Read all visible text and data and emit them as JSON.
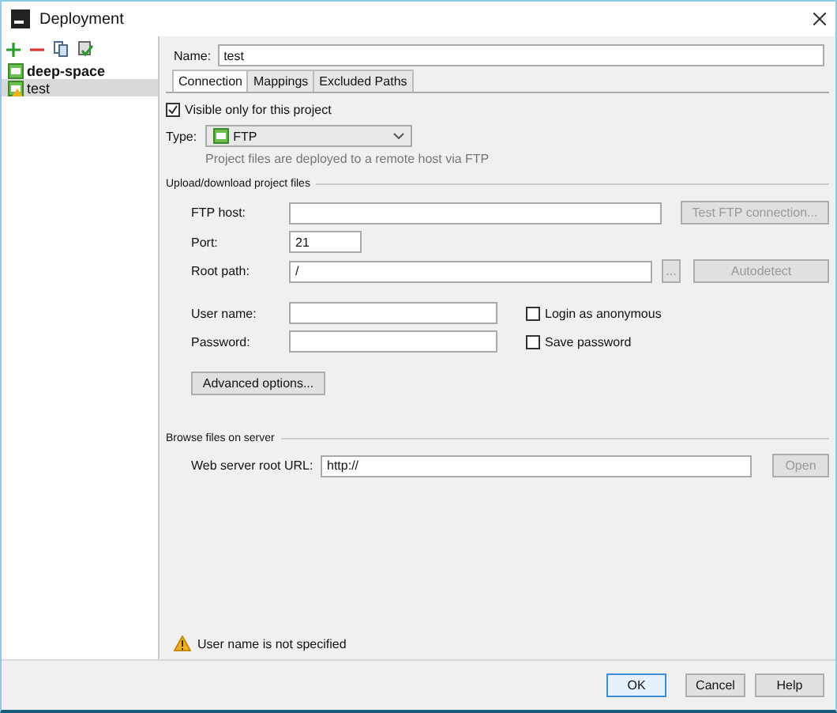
{
  "window": {
    "title": "Deployment"
  },
  "servers": [
    {
      "label": "deep-space",
      "default": true,
      "warning": false,
      "selected": false
    },
    {
      "label": "test",
      "default": false,
      "warning": true,
      "selected": true
    }
  ],
  "name": {
    "label": "Name:",
    "value": "test"
  },
  "tabs": [
    {
      "label": "Connection",
      "selected": true
    },
    {
      "label": "Mappings",
      "selected": false
    },
    {
      "label": "Excluded Paths",
      "selected": false
    }
  ],
  "visible_only": {
    "label": "Visible only for this project",
    "checked": true
  },
  "type": {
    "label": "Type:",
    "value": "FTP",
    "hint": "Project files are deployed to a remote host via FTP"
  },
  "upload_section": {
    "title": "Upload/download project files"
  },
  "ftp_host": {
    "label": "FTP host:",
    "button": {
      "label": "Test FTP connection...",
      "disabled": true
    }
  },
  "port": {
    "label": "Port:",
    "value": "21"
  },
  "root_path": {
    "label": "Root path:",
    "value": "/",
    "browse_button": {
      "label": "...",
      "disabled": true
    },
    "button": {
      "label": "Autodetect",
      "disabled": true
    }
  },
  "user_name": {
    "label": "User name:",
    "option": {
      "label": "Login as anonymous",
      "checked": false
    }
  },
  "password": {
    "label": "Password:",
    "option": {
      "label": "Save password",
      "checked": false
    }
  },
  "advanced_button": "Advanced options...",
  "browse_section": {
    "title": "Browse files on server",
    "label": "Web server root URL:",
    "value": "http://",
    "button": {
      "label": "Open",
      "disabled": true
    }
  },
  "status": {
    "kind": "warning",
    "message": "User name is not specified"
  },
  "buttons": [
    {
      "label": "OK",
      "default": true
    },
    {
      "label": "Cancel",
      "default": false
    },
    {
      "label": "Help",
      "default": false
    }
  ]
}
